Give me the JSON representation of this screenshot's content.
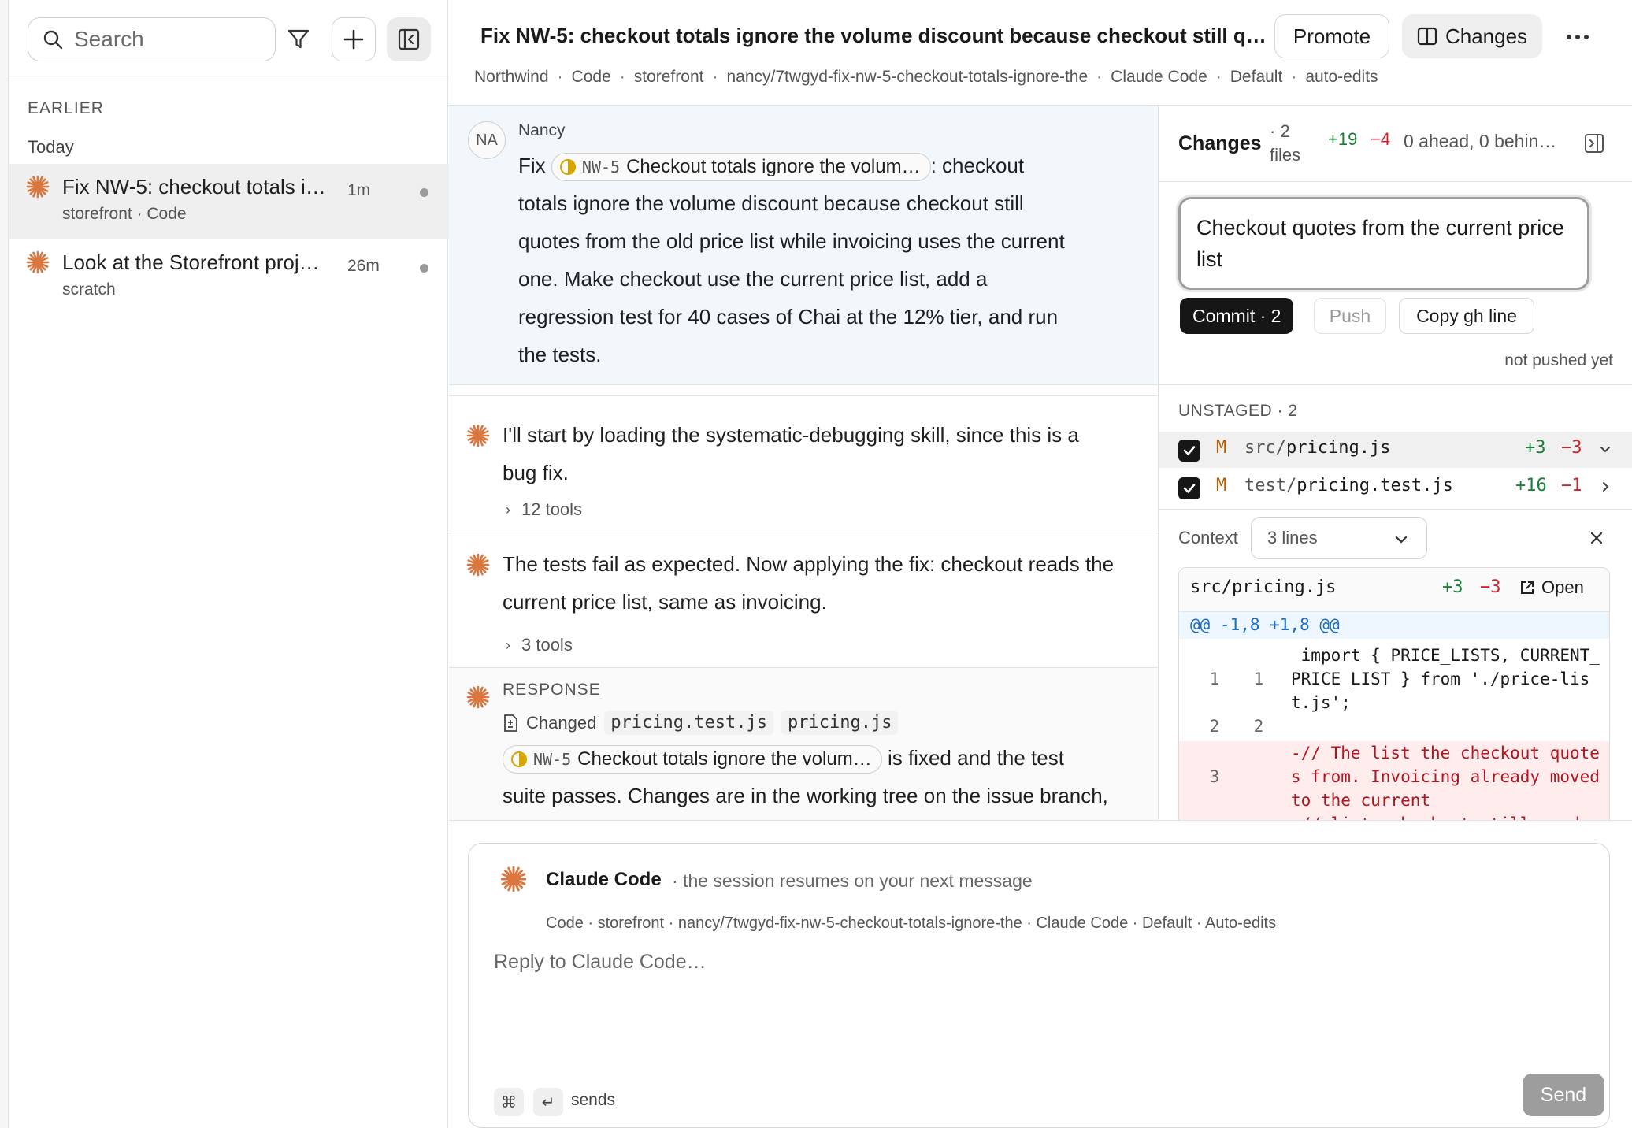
{
  "colors": {
    "accent_star": "#d9773f",
    "add": "#1a7f37",
    "del": "#cf222e",
    "hunk": "#1a6ec4",
    "status_yellow": "#d8a400"
  },
  "sidebar": {
    "search_placeholder": "Search",
    "section": "EARLIER",
    "group": "Today",
    "sessions": [
      {
        "title": "Fix NW-5: checkout totals i…",
        "meta": "storefront · Code",
        "age": "1m"
      },
      {
        "title": "Look at the Storefront proj…",
        "meta": "scratch",
        "age": "26m"
      }
    ],
    "icons": [
      "search-icon",
      "filter-icon",
      "plus-icon",
      "collapse-sidebar-icon"
    ]
  },
  "header": {
    "title": "Fix NW-5: checkout totals ignore the volume discount because checkout still q…",
    "promote_label": "Promote",
    "changes_label": "Changes",
    "breadcrumbs": [
      "Northwind",
      "Code",
      "storefront",
      "nancy/7twgyd-fix-nw-5-checkout-totals-ignore-the",
      "Claude Code",
      "Default",
      "auto-edits"
    ]
  },
  "conversation": {
    "user": {
      "initials": "NA",
      "name": "Nancy",
      "prefix": "Fix",
      "chip_key": "NW-5",
      "chip_title": "Checkout totals ignore the volum…",
      "rest_first": ": checkout",
      "lines": [
        "totals ignore the volume discount because checkout still",
        "quotes from the old price list while invoicing uses the current",
        "one. Make checkout use the current price list, add a",
        "regression test for 40 cases of Chai at the 12% tier, and run",
        "the tests."
      ]
    },
    "assistant": [
      {
        "lines": [
          "I'll start by loading the systematic-debugging skill, since this is a",
          "bug fix."
        ],
        "tools": "12 tools"
      },
      {
        "lines": [
          "The tests fail as expected. Now applying the fix: checkout reads the",
          "current price list, same as invoicing."
        ],
        "tools": "3 tools"
      }
    ],
    "response": {
      "label": "RESPONSE",
      "changed_label": "Changed",
      "files": [
        "pricing.test.js",
        "pricing.js"
      ],
      "chip_key": "NW-5",
      "chip_title": "Checkout totals ignore the volum…",
      "after_chip": "is fixed and the test",
      "line2": "suite passes. Changes are in the working tree on the issue branch,"
    }
  },
  "changes": {
    "title": "Changes",
    "count_a": "· 2",
    "count_b": "files",
    "additions": "+19",
    "deletions": "−4",
    "branch_status": "0 ahead, 0 behin…",
    "commit_message": "Checkout quotes from the current price list",
    "commit_label": "Commit · 2",
    "push_label": "Push",
    "copy_label": "Copy gh line",
    "push_status": "not pushed yet",
    "unstaged_label": "UNSTAGED · 2",
    "files": [
      {
        "status": "M",
        "dir": "src/",
        "name": "pricing.js",
        "add": "+3",
        "del": "−3"
      },
      {
        "status": "M",
        "dir": "test/",
        "name": "pricing.test.js",
        "add": "+16",
        "del": "−1"
      }
    ],
    "context_label": "Context",
    "context_value": "3 lines",
    "diff": {
      "file": "src/pricing.js",
      "add": "+3",
      "del": "−3",
      "open_label": "Open",
      "hunk": "@@ -1,8 +1,8 @@",
      "lines": [
        {
          "old": "1",
          "new": "1",
          "type": "ctx",
          "text": " import { PRICE_LISTS, CURRENT_PRICE_LIST } from './price-list.js';"
        },
        {
          "old": "2",
          "new": "2",
          "type": "ctx",
          "text": ""
        },
        {
          "old": "3",
          "new": "",
          "type": "del",
          "text": "-// The list the checkout quotes from. Invoicing already moved to the current"
        },
        {
          "old": "",
          "new": "",
          "type": "del",
          "text": "-// list; checkout still read"
        }
      ]
    }
  },
  "composer": {
    "agent_name": "Claude Code",
    "agent_status": "· the session resumes on your next message",
    "context_line": "Code · storefront · nancy/7twgyd-fix-nw-5-checkout-totals-ignore-the · Claude Code · Default · Auto-edits",
    "placeholder": "Reply to Claude Code…",
    "cmd_key": "⌘",
    "enter_key": "↵",
    "sends_label": "sends",
    "send_label": "Send"
  }
}
